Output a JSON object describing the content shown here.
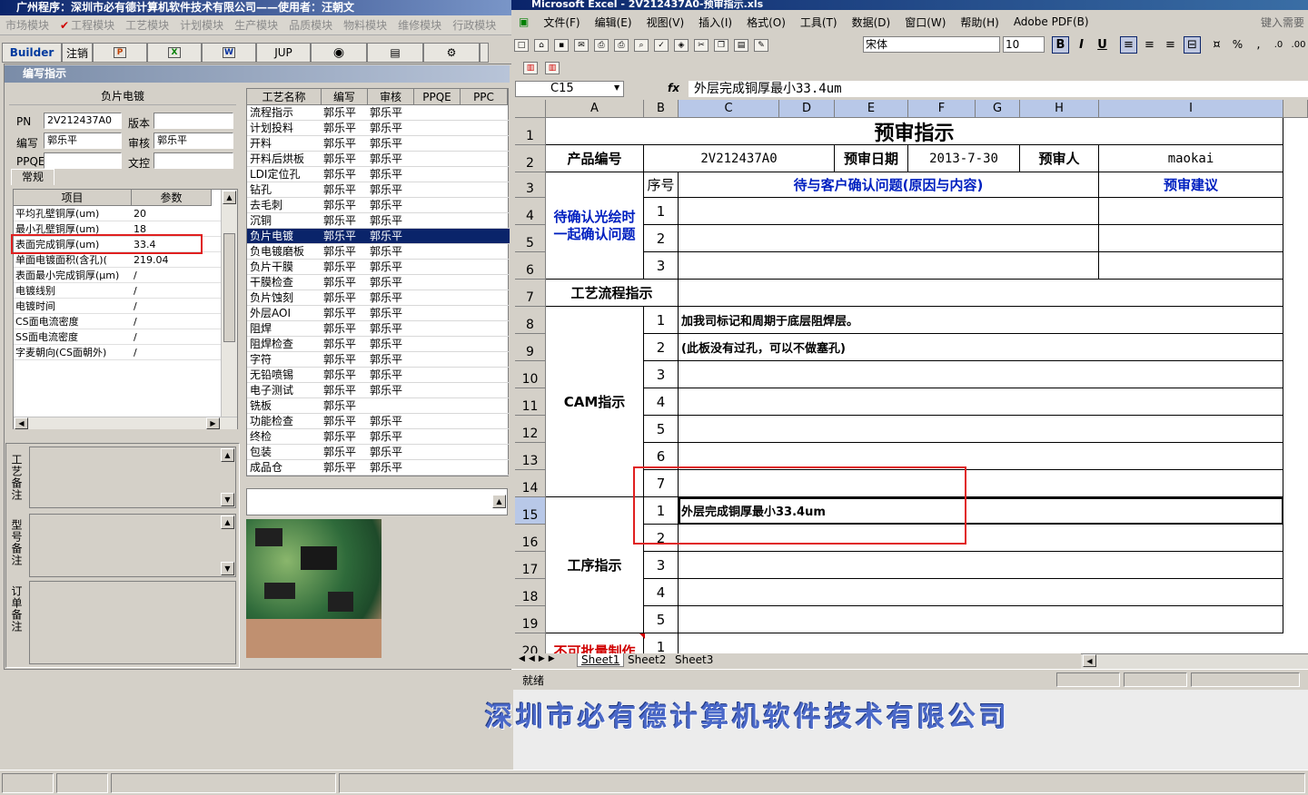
{
  "app": {
    "title": "广州程序：深圳市必有德计算机软件技术有限公司——使用者：汪朝文",
    "menu": [
      "市场模块",
      "工程模块",
      "工艺模块",
      "计划模块",
      "生产模块",
      "品质模块",
      "物料模块",
      "维修模块",
      "行政模块"
    ],
    "active_menu": "工程模块",
    "toolbar": {
      "builder": "Builder",
      "logout": "注销",
      "jup": "JUP"
    },
    "window_title": "编写指示",
    "group_header": "负片电镀",
    "fields": {
      "pn_label": "PN",
      "pn_value": "2V212437A0",
      "version_label": "版本",
      "version_value": "",
      "author_label": "编写",
      "author_value": "郭乐平",
      "reviewer_label": "审核",
      "reviewer_value": "郭乐平",
      "ppqe_label": "PPQE",
      "ppqe_value": "",
      "doc_label": "文控",
      "doc_value": ""
    },
    "tab_label": "常规",
    "param_headers": [
      "项目",
      "参数"
    ],
    "params": [
      {
        "name": "平均孔壁铜厚(um)",
        "value": "20"
      },
      {
        "name": "最小孔壁铜厚(um)",
        "value": "18"
      },
      {
        "name": "表面完成铜厚(um)",
        "value": "33.4"
      },
      {
        "name": "单面电镀面积(含孔)(",
        "value": "219.04"
      },
      {
        "name": "表面最小完成铜厚(μm)",
        "value": "/"
      },
      {
        "name": "电镀线别",
        "value": "/"
      },
      {
        "name": "电镀时间",
        "value": "/"
      },
      {
        "name": "CS面电流密度",
        "value": "/"
      },
      {
        "name": "SS面电流密度",
        "value": "/"
      },
      {
        "name": "字麦朝向(CS面朝外)",
        "value": "/"
      }
    ],
    "memo_labels": [
      "工艺备注",
      "型号备注",
      "订单备注"
    ],
    "proc_headers": [
      "工艺名称",
      "编写",
      "审核",
      "PPQE",
      "PPC"
    ],
    "processes": [
      {
        "name": "流程指示",
        "author": "郭乐平",
        "reviewer": "郭乐平"
      },
      {
        "name": "计划投料",
        "author": "郭乐平",
        "reviewer": "郭乐平"
      },
      {
        "name": "开料",
        "author": "郭乐平",
        "reviewer": "郭乐平"
      },
      {
        "name": "开料后烘板",
        "author": "郭乐平",
        "reviewer": "郭乐平"
      },
      {
        "name": "LDI定位孔",
        "author": "郭乐平",
        "reviewer": "郭乐平"
      },
      {
        "name": "钻孔",
        "author": "郭乐平",
        "reviewer": "郭乐平"
      },
      {
        "name": "去毛刺",
        "author": "郭乐平",
        "reviewer": "郭乐平"
      },
      {
        "name": "沉铜",
        "author": "郭乐平",
        "reviewer": "郭乐平"
      },
      {
        "name": "负片电镀",
        "author": "郭乐平",
        "reviewer": "郭乐平"
      },
      {
        "name": "负电镀磨板",
        "author": "郭乐平",
        "reviewer": "郭乐平"
      },
      {
        "name": "负片干膜",
        "author": "郭乐平",
        "reviewer": "郭乐平"
      },
      {
        "name": "干膜检查",
        "author": "郭乐平",
        "reviewer": "郭乐平"
      },
      {
        "name": "负片蚀刻",
        "author": "郭乐平",
        "reviewer": "郭乐平"
      },
      {
        "name": "外层AOI",
        "author": "郭乐平",
        "reviewer": "郭乐平"
      },
      {
        "name": "阻焊",
        "author": "郭乐平",
        "reviewer": "郭乐平"
      },
      {
        "name": "阻焊检查",
        "author": "郭乐平",
        "reviewer": "郭乐平"
      },
      {
        "name": "字符",
        "author": "郭乐平",
        "reviewer": "郭乐平"
      },
      {
        "name": "无铅喷锡",
        "author": "郭乐平",
        "reviewer": "郭乐平"
      },
      {
        "name": "电子测试",
        "author": "郭乐平",
        "reviewer": "郭乐平"
      },
      {
        "name": "铣板",
        "author": "郭乐平",
        "reviewer": ""
      },
      {
        "name": "功能检查",
        "author": "郭乐平",
        "reviewer": "郭乐平"
      },
      {
        "name": "终检",
        "author": "郭乐平",
        "reviewer": "郭乐平"
      },
      {
        "name": "包装",
        "author": "郭乐平",
        "reviewer": "郭乐平"
      },
      {
        "name": "成品仓",
        "author": "郭乐平",
        "reviewer": "郭乐平"
      }
    ],
    "selected_process": "负片电镀",
    "banner": "深圳市必有德计算机软件技术有限公司"
  },
  "excel": {
    "title": "Microsoft Excel - 2V212437A0-预审指示.xls",
    "menu": [
      "文件(F)",
      "编辑(E)",
      "视图(V)",
      "插入(I)",
      "格式(O)",
      "工具(T)",
      "数据(D)",
      "窗口(W)",
      "帮助(H)",
      "Adobe PDF(B)"
    ],
    "ask_box": "键入需要",
    "font": "宋体",
    "font_size": "10",
    "name_box": "C15",
    "formula": "外层完成铜厚最小33.4um",
    "columns": [
      "A",
      "B",
      "C",
      "D",
      "E",
      "F",
      "G",
      "H",
      "I"
    ],
    "rows": [
      "1",
      "2",
      "3",
      "4",
      "5",
      "6",
      "7",
      "8",
      "9",
      "10",
      "11",
      "12",
      "13",
      "14",
      "15",
      "16",
      "17",
      "18",
      "19",
      "20"
    ],
    "cells": {
      "title": "预审指示",
      "product_no_label": "产品编号",
      "product_no": "2V212437A0",
      "review_date_label": "预审日期",
      "review_date": "2013-7-30",
      "reviewer_label": "预审人",
      "reviewer": "maokai",
      "seq_label": "序号",
      "confirm_issue": "待与客户确认问题(原因与内容)",
      "review_suggest": "预审建议",
      "pending_label": "待确认光绘时一起确认问题",
      "flow_label": "工艺流程指示",
      "cam_label": "CAM指示",
      "cam_1": "加我司标记和周期于底层阻焊层。",
      "cam_2": "(此板没有过孔，可以不做塞孔)",
      "proc_label": "工序指示",
      "proc_1": "外层完成铜厚最小33.4um",
      "no_mass": "不可批量制作",
      "seq_pending": [
        "1",
        "2",
        "3"
      ],
      "seq_cam": [
        "1",
        "2",
        "3",
        "4",
        "5",
        "6",
        "7"
      ],
      "seq_proc": [
        "1",
        "2",
        "3",
        "4",
        "5"
      ],
      "seq_20": "1"
    },
    "sheet_tabs": [
      "Sheet1",
      "Sheet2",
      "Sheet3"
    ],
    "status": "就绪"
  }
}
